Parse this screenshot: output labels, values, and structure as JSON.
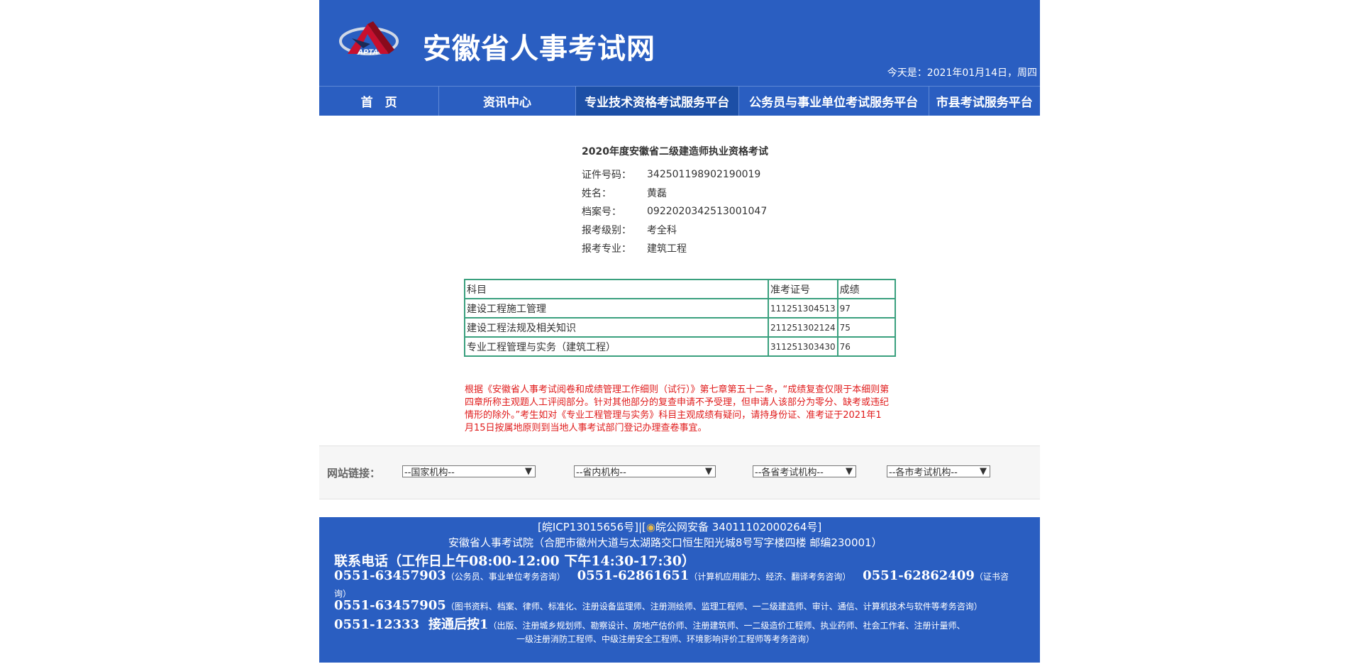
{
  "header": {
    "site_title": "安徽省人事考试网",
    "logo_text": "APTA",
    "date": "今天是：2021年01月14日，周四"
  },
  "nav": [
    "首　页",
    "资讯中心",
    "专业技术资格考试服务平台",
    "公务员与事业单位考试服务平台",
    "市县考试服务平台"
  ],
  "exam": {
    "title": "2020年度安徽省二级建造师执业资格考试",
    "fields": [
      {
        "label": "证件号码：",
        "value": "342501198902190019"
      },
      {
        "label": "姓名：",
        "value": "黄磊"
      },
      {
        "label": "档案号：",
        "value": "0922020342513001047"
      },
      {
        "label": "报考级别：",
        "value": "考全科"
      },
      {
        "label": "报考专业：",
        "value": "建筑工程"
      }
    ]
  },
  "scores": {
    "headers": [
      "科目",
      "准考证号",
      "成绩"
    ],
    "rows": [
      [
        "建设工程施工管理",
        "111251304513",
        "97"
      ],
      [
        "建设工程法规及相关知识",
        "211251302124",
        "75"
      ],
      [
        "专业工程管理与实务（建筑工程）",
        "311251303430",
        "76"
      ]
    ]
  },
  "notice": "根据《安徽省人事考试阅卷和成绩管理工作细则（试行）》第七章第五十二条，“成绩复查仅限于本细则第四章所称主观题人工评阅部分。针对其他部分的复查申请不予受理，但申请人该部分为零分、缺考或违纪情形的除外。”考生如对《专业工程管理与实务》科目主观成绩有疑问，请持身份证、准考证于2021年1月15日按属地原则到当地人事考试部门登记办理查卷事宜。",
  "links": {
    "label": "网站链接：",
    "selects": [
      "--国家机构--",
      "--省内机构--",
      "--各省考试机构--",
      "--各市考试机构--"
    ]
  },
  "footer": {
    "icp": "[皖ICP13015656号]|[",
    "police": "皖公网安备 34011102000264号]",
    "address": "安徽省人事考试院（合肥市徽州大道与太湖路交口恒生阳光城8号写字楼四楼 邮编230001）",
    "contact_title": "联系电话（工作日上午08:00-12:00 下午14:30-17:30）",
    "phone1": "0551-63457903",
    "phone1_desc": "（公务员、事业单位考务咨询）",
    "phone2": "0551-62861651",
    "phone2_desc": "（计算机应用能力、经济、翻译考务咨询）",
    "phone3": "0551-62862409",
    "phone3_desc_a": "（证书咨",
    "phone3_desc_b": "询）",
    "phone4": "0551-63457905",
    "phone4_desc": "（图书资料、档案、律师、标准化、注册设备监理师、注册测绘师、监理工程师、一二级建造师、审计、通信、计算机技术与软件等考务咨询）",
    "phone5": "0551-12333",
    "phone5_ext": "接通后按1",
    "phone5_desc_a": "（出版、注册城乡规划师、勘察设计、房地产估价师、注册建筑师、一二级造价工程师、执业药师、社会工作者、注册计量师、",
    "phone5_desc_b": "一级注册消防工程师、中级注册安全工程师、环境影响评价工程师等考务咨询）"
  }
}
